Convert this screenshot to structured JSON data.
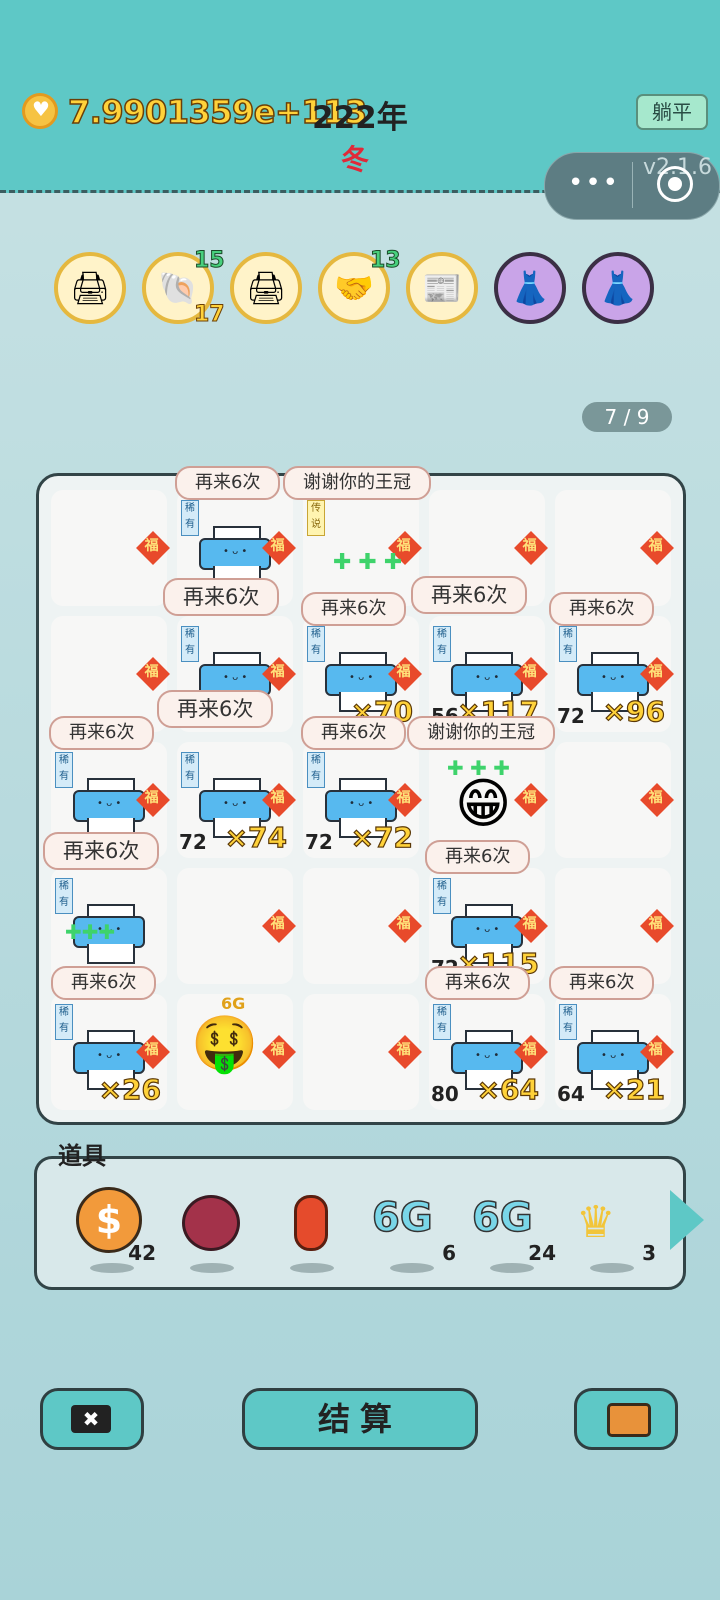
{
  "header": {
    "money": "7.9901359e+113",
    "year": "222年",
    "season": "冬",
    "lie_flat": "躺平",
    "version": "v2.1.6"
  },
  "relics": [
    {
      "icon": "printer-icon",
      "badge": "⚠"
    },
    {
      "icon": "shell-icon",
      "top": "15",
      "bottom": "17"
    },
    {
      "icon": "printer-icon",
      "badge": "⚠"
    },
    {
      "icon": "handshake-icon",
      "top": "13"
    },
    {
      "icon": "time-magazine-icon"
    },
    {
      "icon": "skirt-icon"
    },
    {
      "icon": "skirt-icon"
    }
  ],
  "pager": "7 / 9",
  "board": {
    "fu": "福",
    "rare": "稀有",
    "legend": "传说",
    "bubbles": {
      "again": "再来6次",
      "thanks": "谢谢你的王冠"
    },
    "values": {
      "r2c2": "×70",
      "r2c3": "×117",
      "r2c3_base": "56",
      "r2c4": "×96",
      "r2c4_base": "72",
      "r3c1": "×74",
      "r3c1_base": "72",
      "r3c2": "×72",
      "r3c2_base": "72",
      "r4c3": "×115",
      "r4c3_base": "72",
      "r5c0": "×26",
      "r5c3": "×64",
      "r5c3_base": "80",
      "r5c4": "×21",
      "r5c4_base": "64",
      "sixg": "6G"
    }
  },
  "props": {
    "title": "道具",
    "items": [
      {
        "name": "coin",
        "label": "$",
        "count": "42"
      },
      {
        "name": "lychee",
        "count": ""
      },
      {
        "name": "pepper",
        "count": ""
      },
      {
        "name": "6g-card",
        "label": "6G",
        "count": "6"
      },
      {
        "name": "6g-card",
        "label": "6G",
        "count": "24"
      },
      {
        "name": "crown",
        "count": "3"
      }
    ]
  },
  "buttons": {
    "settle": "结算"
  }
}
